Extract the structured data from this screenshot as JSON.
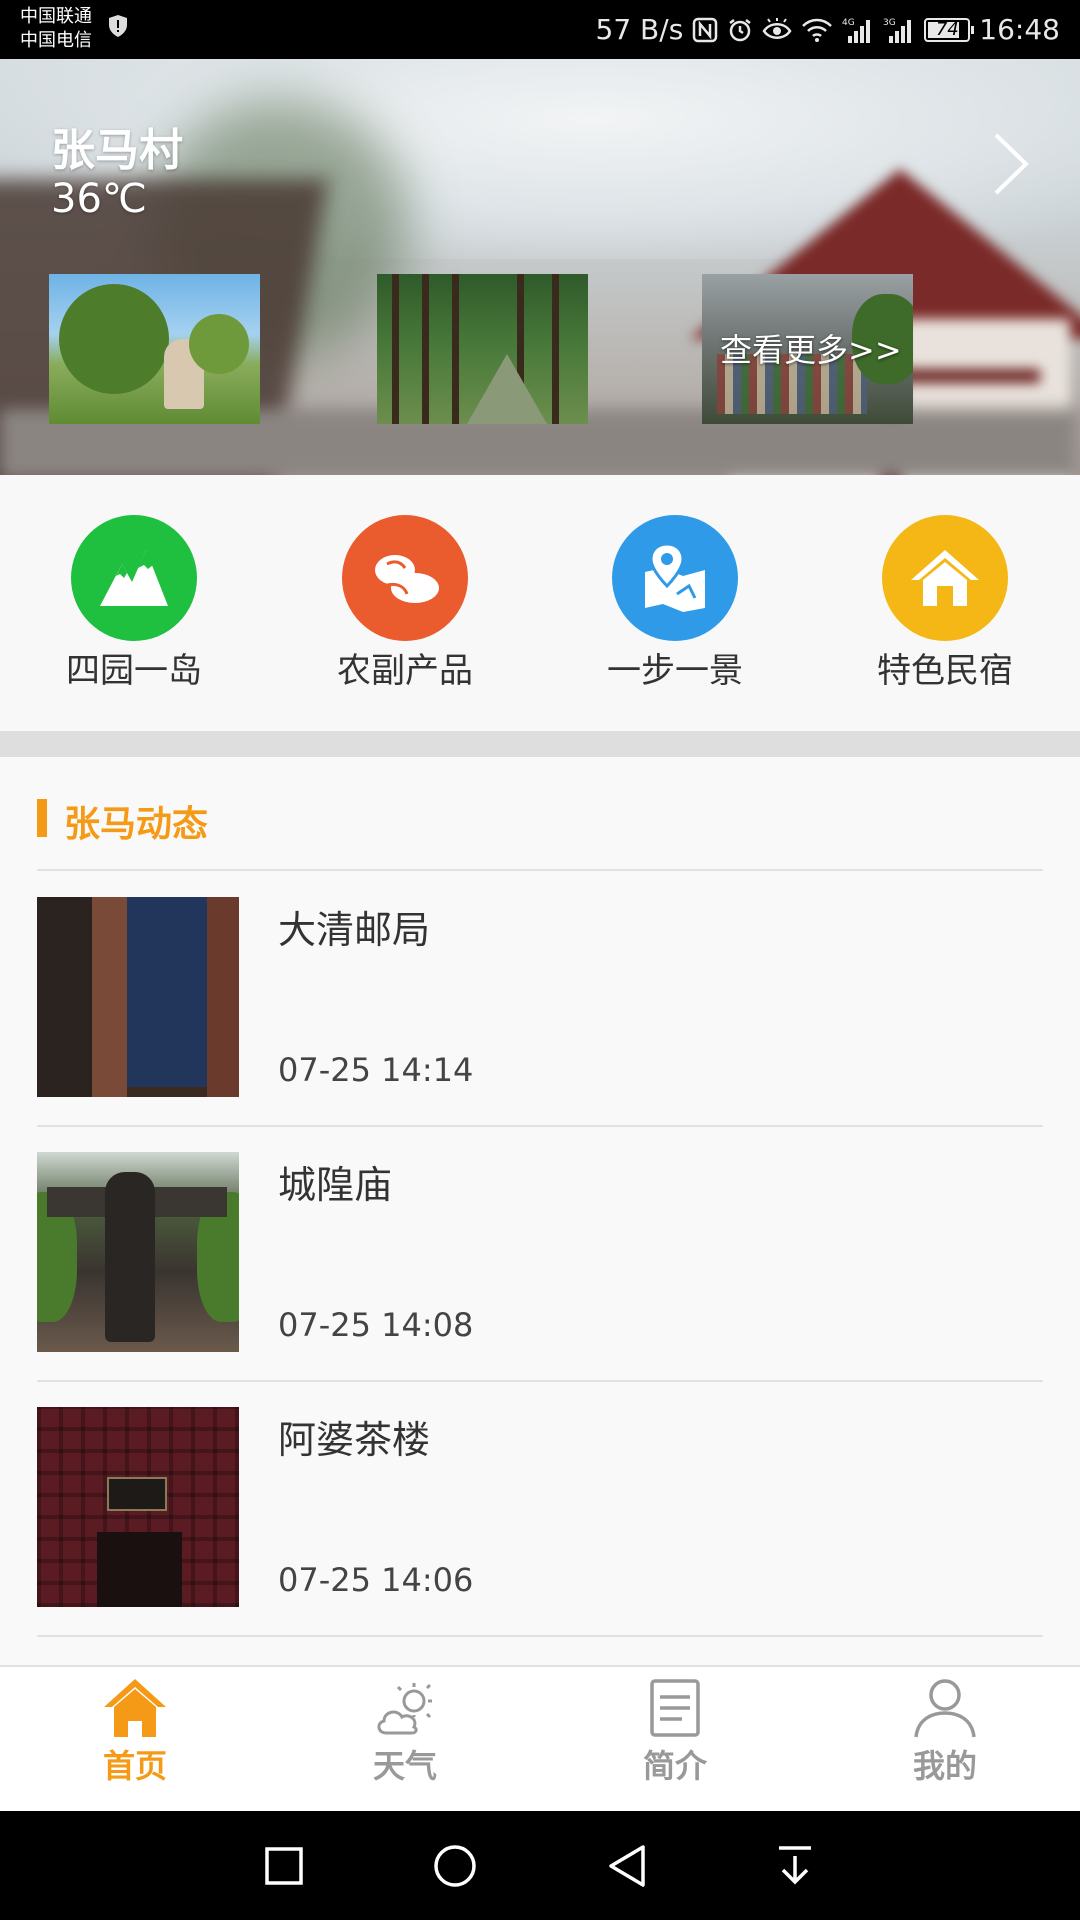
{
  "status_bar": {
    "carrier_1": "中国联通",
    "carrier_2": "中国电信",
    "net_speed": "57 B/s",
    "battery": "74",
    "time": "16:48"
  },
  "hero": {
    "village": "张马村",
    "temperature": "36℃",
    "more_label": "查看更多>>"
  },
  "categories": [
    {
      "label": "四园一岛",
      "icon": "mountain-icon",
      "color": "#1fbf3f"
    },
    {
      "label": "农副产品",
      "icon": "peanut-icon",
      "color": "#ea5b2e"
    },
    {
      "label": "一步一景",
      "icon": "map-pin-icon",
      "color": "#2f9ae8"
    },
    {
      "label": "特色民宿",
      "icon": "house-icon",
      "color": "#f4b716"
    }
  ],
  "news": {
    "section_title": "张马动态",
    "items": [
      {
        "title": "大清邮局",
        "time": "07-25 14:14"
      },
      {
        "title": "城隍庙",
        "time": "07-25 14:08"
      },
      {
        "title": "阿婆茶楼",
        "time": "07-25 14:06"
      }
    ]
  },
  "tabs": [
    {
      "label": "首页",
      "icon": "home-icon",
      "active": true
    },
    {
      "label": "天气",
      "icon": "weather-icon",
      "active": false
    },
    {
      "label": "简介",
      "icon": "document-icon",
      "active": false
    },
    {
      "label": "我的",
      "icon": "user-icon",
      "active": false
    }
  ],
  "colors": {
    "accent": "#f59a17",
    "inactive": "#999999"
  }
}
